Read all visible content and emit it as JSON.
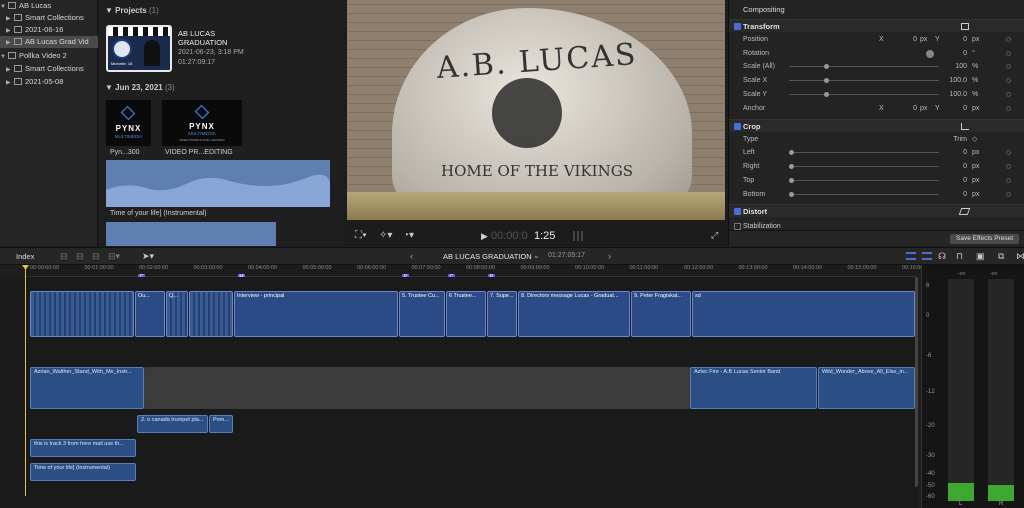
{
  "library": {
    "items": [
      {
        "label": "AB Lucas",
        "kind": "library"
      },
      {
        "label": "Smart Collections",
        "kind": "folder"
      },
      {
        "label": "2021-06-16",
        "kind": "event"
      },
      {
        "label": "AB Lucas Grad Vid",
        "kind": "event",
        "selected": true
      },
      {
        "label": "Pollka Video 2",
        "kind": "library"
      },
      {
        "label": "Smart Collections",
        "kind": "folder"
      },
      {
        "label": "2021-05-08",
        "kind": "event"
      }
    ]
  },
  "browser": {
    "projects_title": "Projects",
    "projects_count": "(1)",
    "project": {
      "name": "AB LUCAS GRADUATION",
      "date": "2021-06-23, 3:18 PM",
      "duration": "01:27:09:17"
    },
    "date_group": "Jun 23, 2021",
    "date_count": "(3)",
    "clip1_name": "Pyn...300",
    "clip2_name": "VIDEO PR...EDITING",
    "clip3_name": "Time of your life] (Instrumental)",
    "logo_text": "PYNX",
    "logo_sub": "MULTIMEDIA",
    "logo_tagline": "VIDEO PRODUCTION • EDITING",
    "thumb_caption": "Michelle, 18"
  },
  "viewer": {
    "rock_title": "A.B. LUCAS",
    "rock_sub": "HOME OF THE VIKINGS",
    "timecode_dim": "00:00:0",
    "timecode": "1:25"
  },
  "inspector": {
    "compositing": "Compositing",
    "transform": "Transform",
    "rows": [
      {
        "label": "Position",
        "x_label": "X",
        "x": "0",
        "x_unit": "px",
        "y_label": "Y",
        "y": "0",
        "y_unit": "px"
      },
      {
        "label": "Rotation",
        "value": "0",
        "unit": "°"
      },
      {
        "label": "Scale (All)",
        "value": "100",
        "unit": "%"
      },
      {
        "label": "Scale X",
        "value": "100.0",
        "unit": "%"
      },
      {
        "label": "Scale Y",
        "value": "100.0",
        "unit": "%"
      },
      {
        "label": "Anchor",
        "x_label": "X",
        "x": "0",
        "x_unit": "px",
        "y_label": "Y",
        "y": "0",
        "y_unit": "px"
      }
    ],
    "crop": "Crop",
    "crop_rows": [
      {
        "label": "Type",
        "value": "Trim",
        "unit": "◇"
      },
      {
        "label": "Left",
        "value": "0",
        "unit": "px"
      },
      {
        "label": "Right",
        "value": "0",
        "unit": "px"
      },
      {
        "label": "Top",
        "value": "0",
        "unit": "px"
      },
      {
        "label": "Bottom",
        "value": "0",
        "unit": "px"
      }
    ],
    "distort": "Distort",
    "stabilization": "Stabilization",
    "save_preset": "Save Effects Preset"
  },
  "timeline": {
    "index_label": "Index",
    "project_title": "AB LUCAS GRADUATION",
    "duration": "01:27:09:17",
    "ruler": [
      "00:00:00:00",
      "00:01:00:00",
      "00:02:00:00",
      "00:03:00:00",
      "00:04:00:00",
      "00:05:00:00",
      "00:06:00:00",
      "00:07:00:00",
      "00:08:00:00",
      "00:09:00:00",
      "00:10:00:00",
      "00:11:00:00",
      "00:12:00:00",
      "00:13:00:00",
      "00:14:00:00",
      "00:15:00:00",
      "00:16:00"
    ],
    "markers": [
      "C",
      "M",
      "P",
      "C",
      "P"
    ],
    "video_clips": [
      "Ou...",
      "Q...",
      "Interview - principal",
      "5. Trustee Cu...",
      "6 Trustee...",
      "7. Supe...",
      "8. Directors message Lucas - Graduat...",
      "9. Peter Fragiskat...",
      "sd"
    ],
    "audio_clips": [
      "Azrian_Walther_Stand_With_Me_Instr...",
      "Aztec Fire - A.B Lucas Senior Band",
      "Wild_Wonder_Above_All_Else_in..."
    ],
    "conn_clips": [
      "2. o canada trumpet pla...",
      "Pom..."
    ],
    "lower_clips": [
      "this is track 3 from here mail use th...",
      "Time of your life] (Instrumental)"
    ]
  },
  "meters": {
    "scale": [
      "6",
      "0",
      "-6",
      "-12",
      "-20",
      "-30",
      "-40",
      "-50",
      "-60"
    ],
    "top_left": "-oo",
    "top_right": "-oo",
    "ch_left": "L",
    "ch_right": "R",
    "level_left": 0.08,
    "level_right": 0.07
  },
  "colors": {
    "accent": "#4b6bd6",
    "video_clip": "#2c4a86",
    "audio_clip": "#2b4f85",
    "playhead": "#e8c33a",
    "meter": "#3da82f"
  }
}
